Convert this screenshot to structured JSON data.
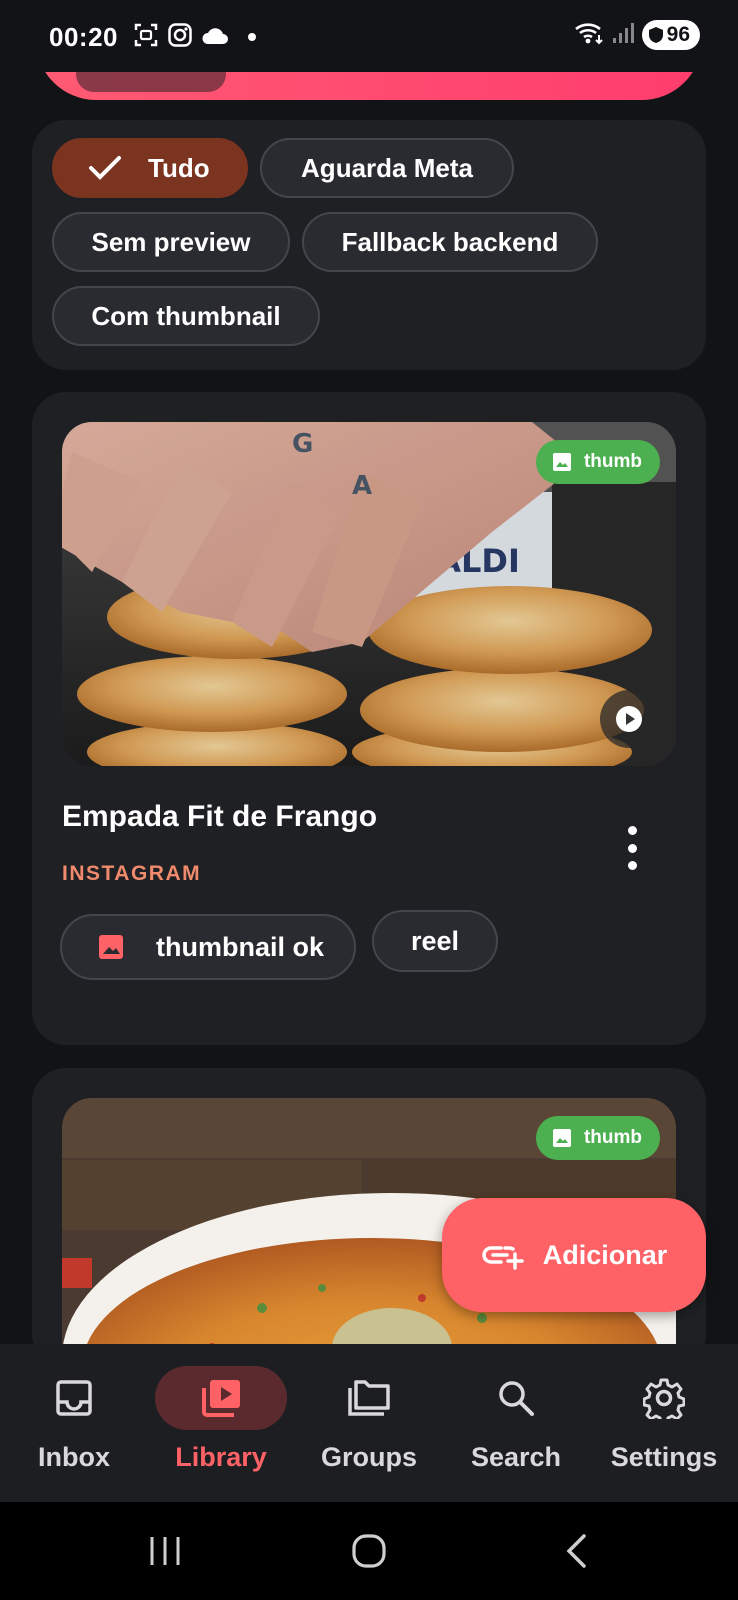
{
  "status_bar": {
    "time": "00:20",
    "battery": "96",
    "icons": [
      "screenshot-icon",
      "instagram-icon",
      "cloud-icon",
      "dot-icon",
      "wifi-icon",
      "signal-icon"
    ]
  },
  "filters": {
    "chips": [
      {
        "label": "Tudo",
        "selected": true
      },
      {
        "label": "Aguarda Meta",
        "selected": false
      },
      {
        "label": "Sem preview",
        "selected": false
      },
      {
        "label": "Fallback backend",
        "selected": false
      },
      {
        "label": "Com thumbnail",
        "selected": false
      }
    ]
  },
  "items": [
    {
      "badge": "thumb",
      "title": "Empada Fit de Frango",
      "source": "INSTAGRAM",
      "tags": [
        "thumbnail ok",
        "reel"
      ]
    },
    {
      "badge": "thumb"
    }
  ],
  "fab": {
    "label": "Adicionar"
  },
  "bottom_nav": {
    "items": [
      {
        "label": "Inbox",
        "icon": "inbox-icon",
        "active": false
      },
      {
        "label": "Library",
        "icon": "video-library-icon",
        "active": true
      },
      {
        "label": "Groups",
        "icon": "folders-icon",
        "active": false
      },
      {
        "label": "Search",
        "icon": "search-icon",
        "active": false
      },
      {
        "label": "Settings",
        "icon": "gear-icon",
        "active": false
      }
    ]
  },
  "colors": {
    "accent": "#ff6266",
    "selected_chip": "#7a3420",
    "source_label": "#f08a6c",
    "thumb_badge": "#4caf50"
  }
}
